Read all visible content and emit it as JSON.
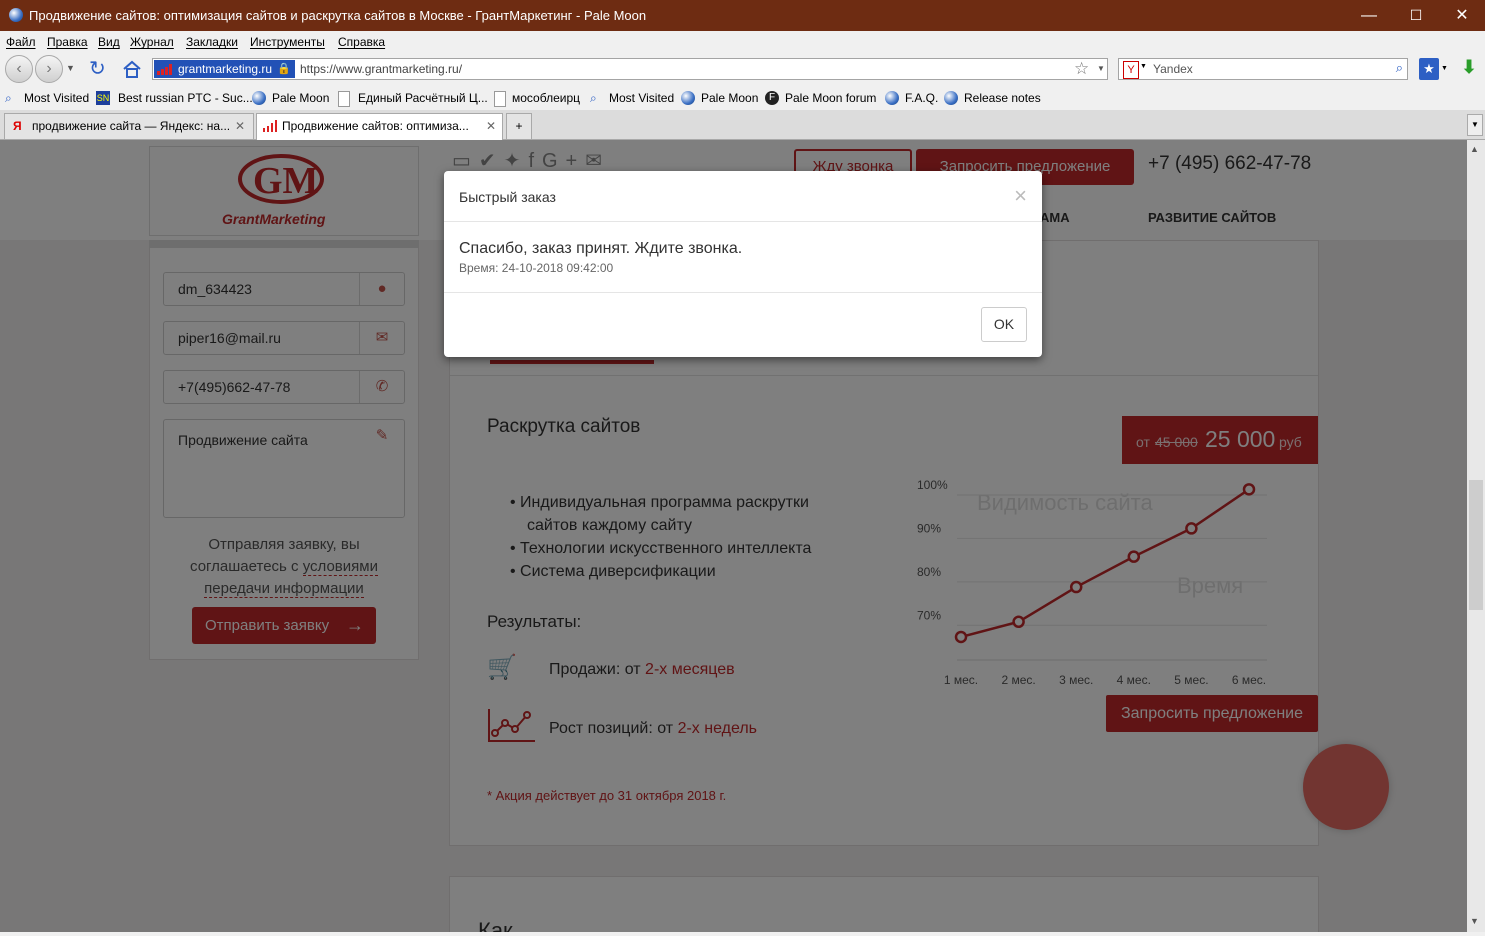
{
  "window": {
    "title": "Продвижение сайтов: оптимизация сайтов и раскрутка сайтов в Москве - ГрантМаркетинг - Pale Moon",
    "minimize": "—",
    "maximize": "☐",
    "close": "✕"
  },
  "menu": [
    "Файл",
    "Правка",
    "Вид",
    "Журнал",
    "Закладки",
    "Инструменты",
    "Справка"
  ],
  "nav": {
    "site_identity": "grantmarketing.ru",
    "url": "https://www.grantmarketing.ru/",
    "search_engine_letter": "Y",
    "search_placeholder": "Yandex"
  },
  "bookmarks": [
    "Most Visited",
    "Best russian PTC - Suc...",
    "Pale Moon",
    "Единый Расчётный Ц...",
    "мособлеирц",
    "Most Visited",
    "Pale Moon",
    "Pale Moon forum",
    "F.A.Q.",
    "Release notes"
  ],
  "bookmark_sn_icon": "SN",
  "tabs": [
    {
      "label": "продвижение сайта — Яндекс: на...",
      "active": false
    },
    {
      "label": "Продвижение сайтов: оптимиза...",
      "active": true
    }
  ],
  "site": {
    "logo_text": "GrantMarketing",
    "btn_callback": "Жду звонка",
    "btn_offer": "Запросить предложение",
    "phone": "+7 (495) 662-47-78",
    "nav_items": [
      "АМА",
      "РАЗВИТИЕ САЙТОВ"
    ],
    "form": {
      "name": "dm_634423",
      "email": "piper16@mail.ru",
      "phone": "+7(495)662-47-78",
      "message": "Продвижение сайта",
      "consent_1": "Отправляя заявку, вы",
      "consent_2": "соглашаетесь с",
      "consent_link_1": "условиями",
      "consent_link_2": "передачи информации",
      "submit": "Отправить заявку"
    },
    "offer": {
      "title": "Раскрутка сайтов",
      "price_from": "от",
      "price_old": "45 000",
      "price_new": "25 000",
      "price_unit": "руб",
      "bullets": [
        "Индивидуальная программа раскрутки",
        "сайтов каждому сайту",
        "Технологии искусственного интеллекта",
        "Система диверсификации"
      ],
      "results_title": "Результаты:",
      "sales_label": "Продажи: от",
      "sales_value": "2-х месяцев",
      "growth_label": "Рост позиций: от",
      "growth_value": "2-х недель",
      "promo": "* Акция действует до 31 октября 2018 г.",
      "button": "Запросить предложение",
      "next_heading": "Как"
    }
  },
  "chart_data": {
    "type": "line",
    "title": "Видимость сайта",
    "xlabel": "Время",
    "ylabel": "",
    "categories": [
      "1 мес.",
      "2 мес.",
      "3 мес.",
      "4 мес.",
      "5 мес.",
      "6 мес."
    ],
    "y_ticks": [
      "100%",
      "90%",
      "80%",
      "70%"
    ],
    "ylim": [
      62,
      100
    ],
    "series": [
      {
        "values": [
          65,
          68.5,
          76.5,
          83.5,
          90,
          99
        ],
        "color": "#c0282b"
      }
    ],
    "grid": true
  },
  "modal": {
    "title": "Быстрый заказ",
    "close": "×",
    "message": "Спасибо, заказ принят. Ждите звонка.",
    "time": "Время: 24-10-2018 09:42:00",
    "ok": "OK"
  },
  "colors": {
    "brand_red": "#c0282b",
    "titlebar": "#6e2c12",
    "call_bubble": "#e56a63"
  }
}
